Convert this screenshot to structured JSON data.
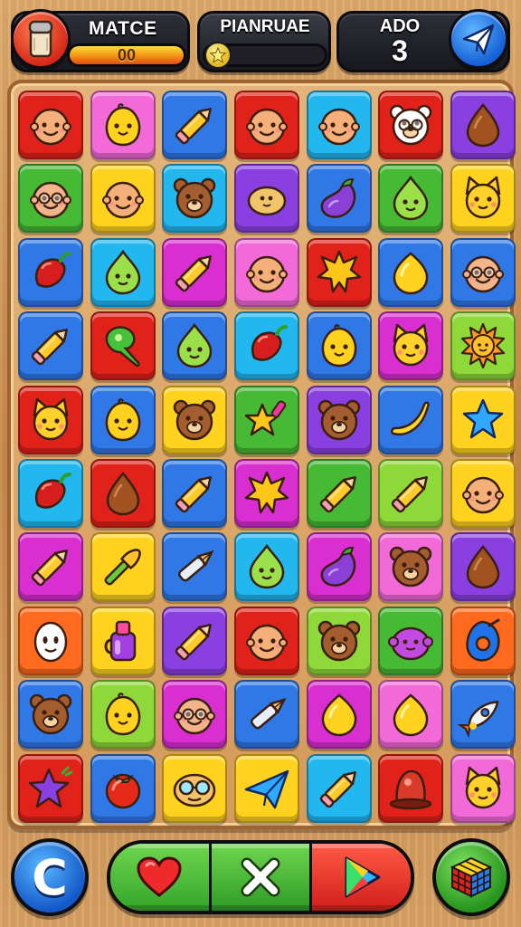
{
  "hud": {
    "left": {
      "label": "MATCE",
      "bar_value": "00",
      "bar_fill": 1.0,
      "icon": "salt-shaker-icon"
    },
    "middle": {
      "label": "PIANRUAE",
      "bar_fill": 0.08,
      "icon": "star-icon"
    },
    "right": {
      "label": "ADO",
      "value": "3",
      "icon": "paper-plane-icon"
    }
  },
  "colors": {
    "red": "#e0221a",
    "pink": "#f26ad8",
    "blue": "#2f78e6",
    "cyan": "#23b7f0",
    "green": "#46b935",
    "yellow": "#ffd21f",
    "purple": "#8a3fe0",
    "magenta": "#d92fd0",
    "orange": "#ff6a1f",
    "lime": "#8fd83a"
  },
  "board": {
    "rows": [
      [
        [
          "red",
          "face"
        ],
        [
          "pink",
          "chick"
        ],
        [
          "blue",
          "pencil"
        ],
        [
          "red",
          "face"
        ],
        [
          "cyan",
          "face"
        ],
        [
          "red",
          "bear-glasses"
        ],
        [
          "purple",
          "seed"
        ]
      ],
      [
        [
          "green",
          "face-glasses"
        ],
        [
          "yellow",
          "face"
        ],
        [
          "cyan",
          "bear"
        ],
        [
          "purple",
          "potato"
        ],
        [
          "blue",
          "eggplant"
        ],
        [
          "green",
          "drop-face"
        ],
        [
          "yellow",
          "cat"
        ]
      ],
      [
        [
          "blue",
          "chili"
        ],
        [
          "cyan",
          "drop-face"
        ],
        [
          "magenta",
          "pencil"
        ],
        [
          "pink",
          "face"
        ],
        [
          "red",
          "star-burst"
        ],
        [
          "blue",
          "lemon"
        ],
        [
          "blue",
          "face-glasses"
        ]
      ],
      [
        [
          "blue",
          "pencil"
        ],
        [
          "red",
          "pin"
        ],
        [
          "blue",
          "drop-face"
        ],
        [
          "cyan",
          "chili"
        ],
        [
          "blue",
          "chick"
        ],
        [
          "magenta",
          "cat"
        ],
        [
          "lime",
          "sun"
        ]
      ],
      [
        [
          "red",
          "cat"
        ],
        [
          "blue",
          "chick"
        ],
        [
          "yellow",
          "bear"
        ],
        [
          "green",
          "star-pencil"
        ],
        [
          "purple",
          "bear"
        ],
        [
          "blue",
          "banana"
        ],
        [
          "yellow",
          "star"
        ]
      ],
      [
        [
          "cyan",
          "chili"
        ],
        [
          "red",
          "seed"
        ],
        [
          "blue",
          "pencil"
        ],
        [
          "magenta",
          "star-burst"
        ],
        [
          "green",
          "pencil"
        ],
        [
          "lime",
          "pencil"
        ],
        [
          "yellow",
          "face"
        ]
      ],
      [
        [
          "magenta",
          "pencil"
        ],
        [
          "yellow",
          "brush"
        ],
        [
          "blue",
          "pen"
        ],
        [
          "cyan",
          "drop-face"
        ],
        [
          "magenta",
          "eggplant"
        ],
        [
          "pink",
          "bear"
        ],
        [
          "purple",
          "seed"
        ]
      ],
      [
        [
          "orange",
          "egg-face"
        ],
        [
          "yellow",
          "bottle"
        ],
        [
          "purple",
          "pencil"
        ],
        [
          "red",
          "face"
        ],
        [
          "lime",
          "bear"
        ],
        [
          "green",
          "blob"
        ],
        [
          "orange",
          "ring"
        ]
      ],
      [
        [
          "blue",
          "bear"
        ],
        [
          "lime",
          "chick"
        ],
        [
          "magenta",
          "face-glasses"
        ],
        [
          "blue",
          "pen"
        ],
        [
          "magenta",
          "lemon"
        ],
        [
          "pink",
          "lemon"
        ],
        [
          "blue",
          "rocket"
        ]
      ],
      [
        [
          "red",
          "purple-star"
        ],
        [
          "blue",
          "tomato"
        ],
        [
          "yellow",
          "glasses"
        ],
        [
          "yellow",
          "plane"
        ],
        [
          "cyan",
          "pencil"
        ],
        [
          "red",
          "hat"
        ],
        [
          "pink",
          "cat"
        ]
      ]
    ]
  },
  "controls": {
    "left_button": {
      "letter": "C",
      "icon": "c-letter-icon"
    },
    "actions": [
      "heart-icon",
      "close-icon",
      "play-icon"
    ],
    "right_button": {
      "icon": "rubiks-cube-icon"
    }
  }
}
